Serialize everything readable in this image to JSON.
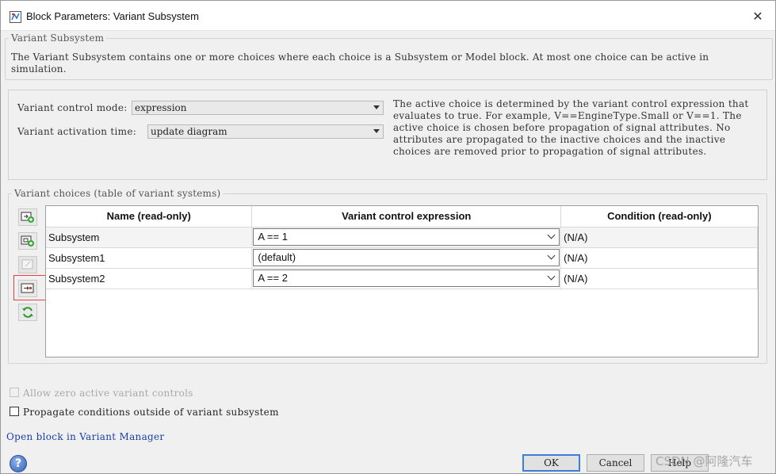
{
  "window": {
    "title": "Block Parameters: Variant Subsystem"
  },
  "block": {
    "group_title": "Variant Subsystem",
    "description": "The Variant Subsystem contains one or more choices where each choice is a Subsystem or Model block. At most one choice can be active in simulation."
  },
  "variant_control": {
    "mode_label": "Variant control mode:",
    "mode_value": "expression",
    "activation_label": "Variant activation time:",
    "activation_value": "update diagram",
    "info": "The active choice is determined by the variant control expression that evaluates to true. For example, V==EngineType.Small or V==1. The active choice is chosen before propagation of signal attributes. No attributes are propagated to the inactive choices and the inactive choices are removed prior to propagation of signal attributes."
  },
  "choices": {
    "group_title": "Variant choices (table of variant systems)",
    "columns": [
      "Name (read-only)",
      "Variant control expression",
      "Condition (read-only)"
    ],
    "rows": [
      {
        "name": "Subsystem",
        "expression": "A == 1",
        "condition": "(N/A)"
      },
      {
        "name": "Subsystem1",
        "expression": "(default)",
        "condition": "(N/A)"
      },
      {
        "name": "Subsystem2",
        "expression": "A == 2",
        "condition": "(N/A)"
      }
    ],
    "toolbar_icons": [
      "add-subsystem-choice-icon",
      "add-model-choice-icon",
      "disabled-choice-icon",
      "create-variant-choice-icon",
      "refresh-icon"
    ]
  },
  "options": {
    "allow_zero_label": "Allow zero active variant controls",
    "allow_zero_checked": false,
    "propagate_label": "Propagate conditions outside of variant subsystem",
    "propagate_checked": false
  },
  "link": {
    "label": "Open block in Variant Manager"
  },
  "buttons": {
    "ok": "OK",
    "cancel": "Cancel",
    "help": "Help"
  },
  "watermark": "CSDN @阿隆汽车",
  "colors": {
    "accent_default_button": "#3c7fd8",
    "link": "#1a3faa",
    "highlight": "#e04040"
  }
}
